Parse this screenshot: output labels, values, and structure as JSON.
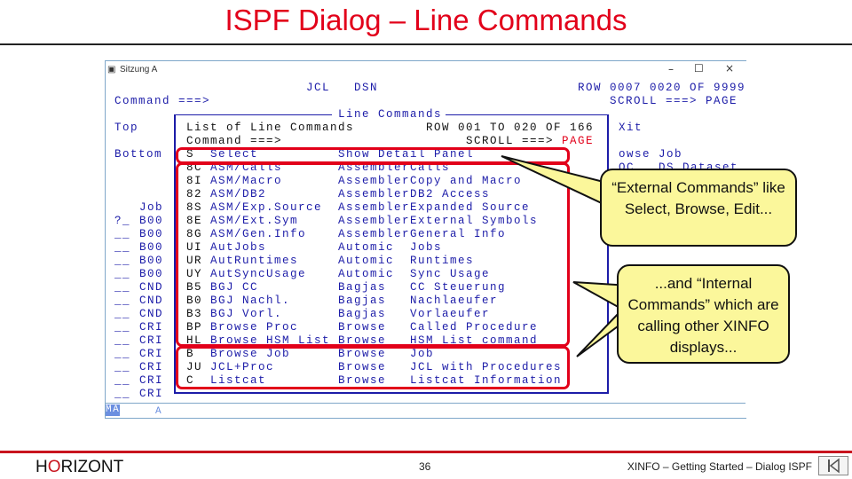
{
  "slide": {
    "title": "ISPF Dialog – Line Commands",
    "footer": {
      "logo": "HORIZONT",
      "logo_prefix": "H",
      "logo_o": "O",
      "logo_suffix": "RIZONT",
      "page": "36",
      "text": "XINFO – Getting Started – Dialog ISPF",
      "nav_icon": "first-page-icon"
    }
  },
  "terminal": {
    "window_title": "Sitzung A",
    "window_controls": {
      "minimize": "–",
      "maximize": "☐",
      "close": "×"
    },
    "header": {
      "jcl": "JCL",
      "dsn": "DSN",
      "row_info": "ROW 0007 0020 OF 9999",
      "command_label": "Command ===>",
      "scroll_label": "SCROLL ===>",
      "scroll_value": "PAGE"
    },
    "left_labels": {
      "top": "Top",
      "bottom": "Bottom",
      "job_header": "Job"
    },
    "left_rows": [
      {
        "sel": "?_",
        "job": "B00"
      },
      {
        "sel": "__",
        "job": "B00"
      },
      {
        "sel": "__",
        "job": "B00"
      },
      {
        "sel": "__",
        "job": "B00"
      },
      {
        "sel": "__",
        "job": "B00"
      },
      {
        "sel": "__",
        "job": "CND"
      },
      {
        "sel": "__",
        "job": "CND"
      },
      {
        "sel": "__",
        "job": "CND"
      },
      {
        "sel": "__",
        "job": "CRI"
      },
      {
        "sel": "__",
        "job": "CRI"
      },
      {
        "sel": "__",
        "job": "CRI"
      },
      {
        "sel": "__",
        "job": "CRI"
      },
      {
        "sel": "__",
        "job": "CRI"
      },
      {
        "sel": "__",
        "job": "CRI"
      }
    ],
    "right_texts": {
      "xit": "Xit",
      "browse_job": "owse Job",
      "dataset": "OC   DS Dataset"
    },
    "status": {
      "mode": "MA",
      "indicator": "A"
    }
  },
  "popup": {
    "frame_title": "Line Commands",
    "heading": "List of Line Commands",
    "row_info": "ROW 001 TO 020 OF 166",
    "command_label": "Command ===>",
    "scroll_label": "SCROLL ===>",
    "scroll_value": "PAGE",
    "rows": [
      {
        "code": "S",
        "name": "Select",
        "category": "Show Detail Panel",
        "desc": ""
      },
      {
        "code": "8C",
        "name": "ASM/Calls",
        "category": "Assembler",
        "desc": "Calls"
      },
      {
        "code": "8I",
        "name": "ASM/Macro",
        "category": "Assembler",
        "desc": "Copy and Macro"
      },
      {
        "code": "82",
        "name": "ASM/DB2",
        "category": "Assembler",
        "desc": "DB2 Access"
      },
      {
        "code": "8S",
        "name": "ASM/Exp.Source",
        "category": "Assembler",
        "desc": "Expanded Source"
      },
      {
        "code": "8E",
        "name": "ASM/Ext.Sym",
        "category": "Assembler",
        "desc": "External Symbols"
      },
      {
        "code": "8G",
        "name": "ASM/Gen.Info",
        "category": "Assembler",
        "desc": "General Info"
      },
      {
        "code": "UI",
        "name": "AutJobs",
        "category": "Automic",
        "desc": "Jobs"
      },
      {
        "code": "UR",
        "name": "AutRuntimes",
        "category": "Automic",
        "desc": "Runtimes"
      },
      {
        "code": "UY",
        "name": "AutSyncUsage",
        "category": "Automic",
        "desc": "Sync Usage"
      },
      {
        "code": "B5",
        "name": "BGJ CC",
        "category": "Bagjas",
        "desc": "CC Steuerung"
      },
      {
        "code": "B0",
        "name": "BGJ Nachl.",
        "category": "Bagjas",
        "desc": "Nachlaeufer"
      },
      {
        "code": "B3",
        "name": "BGJ Vorl.",
        "category": "Bagjas",
        "desc": "Vorlaeufer"
      },
      {
        "code": "BP",
        "name": "Browse Proc",
        "category": "Browse",
        "desc": "Called Procedure"
      },
      {
        "code": "HL",
        "name": "Browse HSM List",
        "category": "Browse",
        "desc": "HSM List command"
      },
      {
        "code": "B",
        "name": "Browse Job",
        "category": "Browse",
        "desc": "Job"
      },
      {
        "code": "JU",
        "name": "JCL+Proc",
        "category": "Browse",
        "desc": "JCL with Procedures"
      },
      {
        "code": "C",
        "name": "Listcat",
        "category": "Browse",
        "desc": "Listcat Information"
      }
    ]
  },
  "callouts": {
    "external": "“External Commands” like Select, Browse, Edit...",
    "internal": "...and “Internal Commands” which are calling other XINFO displays..."
  },
  "colors": {
    "title": "#e2001a",
    "highlight_box": "#e2001a",
    "terminal_text": "#1c1ca8",
    "callout_fill": "#fbf79b",
    "footer_rule": "#c8141e"
  }
}
